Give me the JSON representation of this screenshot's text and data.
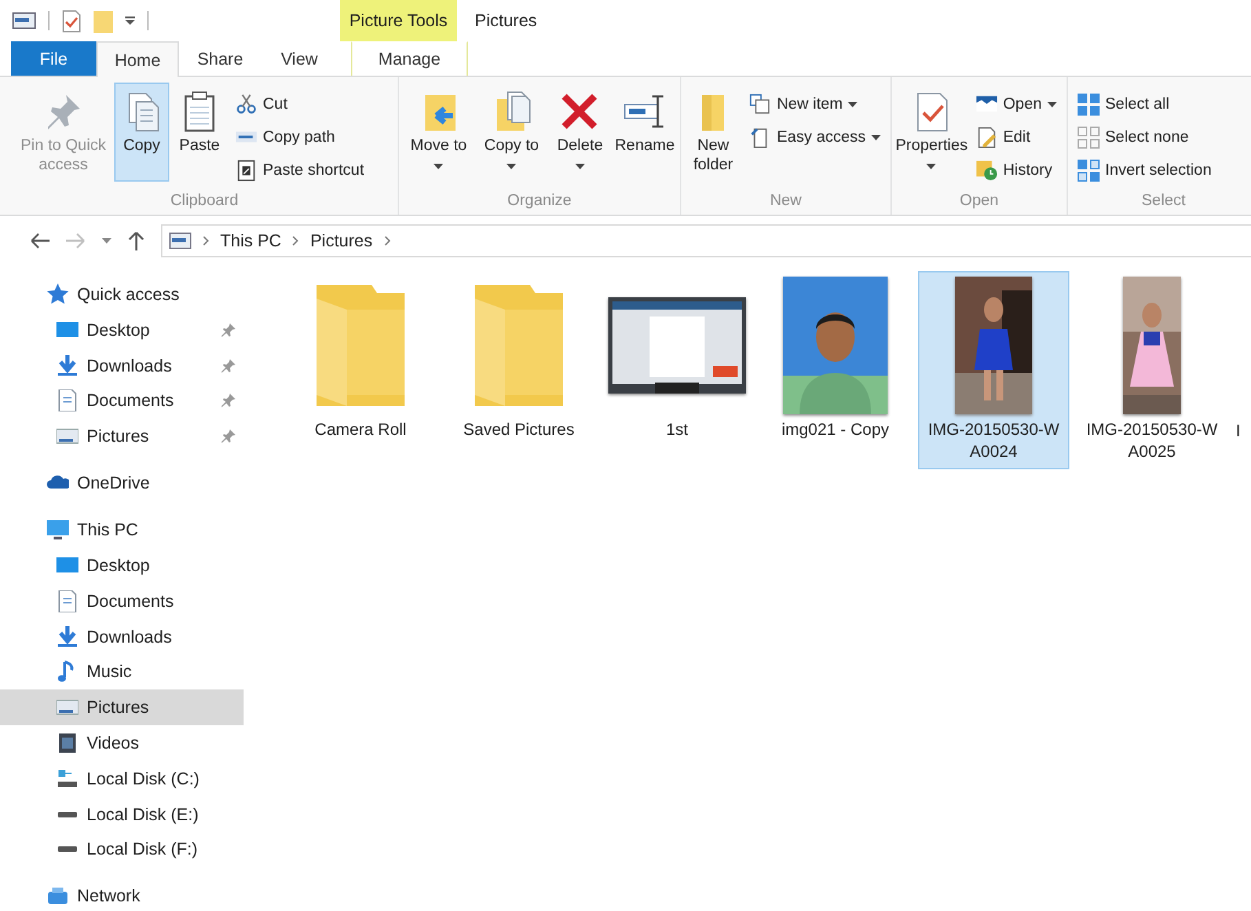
{
  "context_header": {
    "label": "Picture Tools"
  },
  "window": {
    "title": "Pictures"
  },
  "tabs": [
    {
      "label": "File",
      "kind": "file",
      "selected": false
    },
    {
      "label": "Home",
      "kind": "tab",
      "selected": true
    },
    {
      "label": "Share",
      "kind": "tab",
      "selected": false
    },
    {
      "label": "View",
      "kind": "tab",
      "selected": false
    },
    {
      "label": "Manage",
      "kind": "contextual",
      "selected": false
    }
  ],
  "ribbon": {
    "groups": [
      {
        "label": "Clipboard",
        "buttons": [
          {
            "label": "Pin to Quick access",
            "kind": "large",
            "disabled": true,
            "highlighted": false,
            "dropdown": false
          },
          {
            "label": "Copy",
            "kind": "large",
            "disabled": false,
            "highlighted": true,
            "dropdown": false
          },
          {
            "label": "Paste",
            "kind": "large",
            "disabled": false,
            "highlighted": false,
            "dropdown": false
          },
          {
            "label": "Cut",
            "kind": "small",
            "disabled": false,
            "highlighted": false,
            "dropdown": false
          },
          {
            "label": "Copy path",
            "kind": "small",
            "disabled": false,
            "highlighted": false,
            "dropdown": false
          },
          {
            "label": "Paste shortcut",
            "kind": "small",
            "disabled": false,
            "highlighted": false,
            "dropdown": false
          }
        ]
      },
      {
        "label": "Organize",
        "buttons": [
          {
            "label": "Move to",
            "kind": "large",
            "disabled": false,
            "highlighted": false,
            "dropdown": true
          },
          {
            "label": "Copy to",
            "kind": "large",
            "disabled": false,
            "highlighted": false,
            "dropdown": true
          },
          {
            "label": "Delete",
            "kind": "large",
            "disabled": false,
            "highlighted": false,
            "dropdown": true
          },
          {
            "label": "Rename",
            "kind": "large",
            "disabled": false,
            "highlighted": false,
            "dropdown": false
          }
        ]
      },
      {
        "label": "New",
        "buttons": [
          {
            "label": "New folder",
            "kind": "large",
            "disabled": false,
            "highlighted": false,
            "dropdown": false
          },
          {
            "label": "New item",
            "kind": "small",
            "disabled": false,
            "highlighted": false,
            "dropdown": true
          },
          {
            "label": "Easy access",
            "kind": "small",
            "disabled": false,
            "highlighted": false,
            "dropdown": true
          }
        ]
      },
      {
        "label": "Open",
        "buttons": [
          {
            "label": "Properties",
            "kind": "large",
            "disabled": false,
            "highlighted": false,
            "dropdown": true
          },
          {
            "label": "Open",
            "kind": "small",
            "disabled": false,
            "highlighted": false,
            "dropdown": true
          },
          {
            "label": "Edit",
            "kind": "small",
            "disabled": false,
            "highlighted": false,
            "dropdown": false
          },
          {
            "label": "History",
            "kind": "small",
            "disabled": false,
            "highlighted": false,
            "dropdown": false
          }
        ]
      },
      {
        "label": "Select",
        "buttons": [
          {
            "label": "Select all",
            "kind": "small",
            "disabled": false,
            "highlighted": false,
            "dropdown": false
          },
          {
            "label": "Select none",
            "kind": "small",
            "disabled": false,
            "highlighted": false,
            "dropdown": false
          },
          {
            "label": "Invert selection",
            "kind": "small",
            "disabled": false,
            "highlighted": false,
            "dropdown": false
          }
        ]
      }
    ]
  },
  "address_bar": {
    "path": [
      "This PC",
      "Pictures"
    ]
  },
  "nav": [
    {
      "label": "Quick access",
      "selected": false,
      "children": [
        {
          "label": "Desktop",
          "pinned": true,
          "selected": false
        },
        {
          "label": "Downloads",
          "pinned": true,
          "selected": false
        },
        {
          "label": "Documents",
          "pinned": true,
          "selected": false
        },
        {
          "label": "Pictures",
          "pinned": true,
          "selected": false
        }
      ]
    },
    {
      "label": "OneDrive",
      "selected": false
    },
    {
      "label": "This PC",
      "selected": false,
      "children": [
        {
          "label": "Desktop",
          "pinned": false,
          "selected": false
        },
        {
          "label": "Documents",
          "pinned": false,
          "selected": false
        },
        {
          "label": "Downloads",
          "pinned": false,
          "selected": false
        },
        {
          "label": "Music",
          "pinned": false,
          "selected": false
        },
        {
          "label": "Pictures",
          "pinned": false,
          "selected": true
        },
        {
          "label": "Videos",
          "pinned": false,
          "selected": false
        },
        {
          "label": "Local Disk (C:)",
          "pinned": false,
          "selected": false
        },
        {
          "label": "Local Disk (E:)",
          "pinned": false,
          "selected": false
        },
        {
          "label": "Local Disk (F:)",
          "pinned": false,
          "selected": false
        }
      ]
    },
    {
      "label": "Network",
      "selected": false
    }
  ],
  "files": [
    {
      "name": "Camera Roll",
      "kind": "folder",
      "selected": false
    },
    {
      "name": "Saved Pictures",
      "kind": "folder",
      "selected": false
    },
    {
      "name": "1st",
      "kind": "picture",
      "selected": false
    },
    {
      "name": "img021 - Copy",
      "kind": "picture",
      "selected": false
    },
    {
      "name": "IMG-20150530-WA0024",
      "kind": "picture",
      "selected": true
    },
    {
      "name": "IMG-20150530-WA0025",
      "kind": "picture",
      "selected": false
    },
    {
      "name": "I",
      "kind": "partial",
      "selected": false
    }
  ]
}
